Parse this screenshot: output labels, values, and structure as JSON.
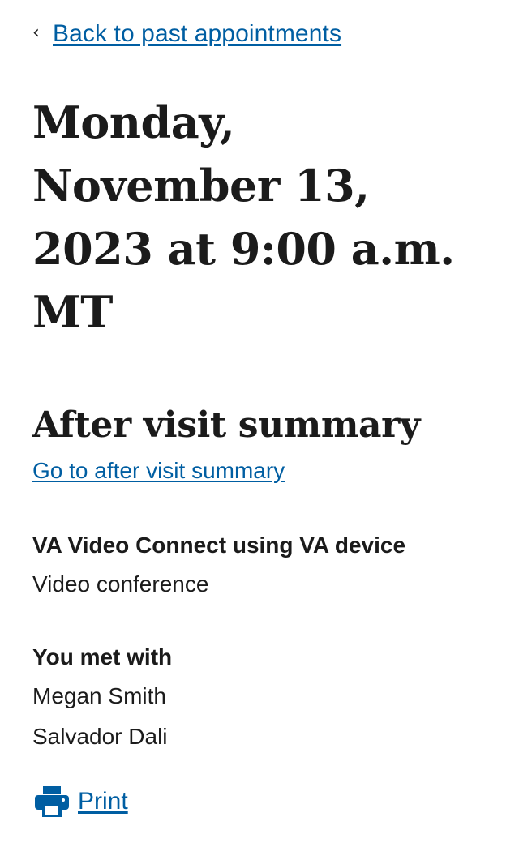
{
  "navigation": {
    "back_label": "Back to past appointments"
  },
  "appointment": {
    "title": "Monday, November 13, 2023 at 9:00 a.m. MT"
  },
  "after_visit_summary": {
    "heading": "After visit summary",
    "link_label": "Go to after visit summary"
  },
  "appointment_type": {
    "heading": "VA Video Connect using VA device",
    "value": "Video conference"
  },
  "met_with": {
    "heading": "You met with",
    "people": [
      "Megan Smith",
      "Salvador Dali"
    ]
  },
  "actions": {
    "print_label": "Print"
  },
  "colors": {
    "link": "#005ea2",
    "text": "#1b1b1b"
  },
  "icons": {
    "back": "chevron-left-icon",
    "print": "printer-icon"
  }
}
